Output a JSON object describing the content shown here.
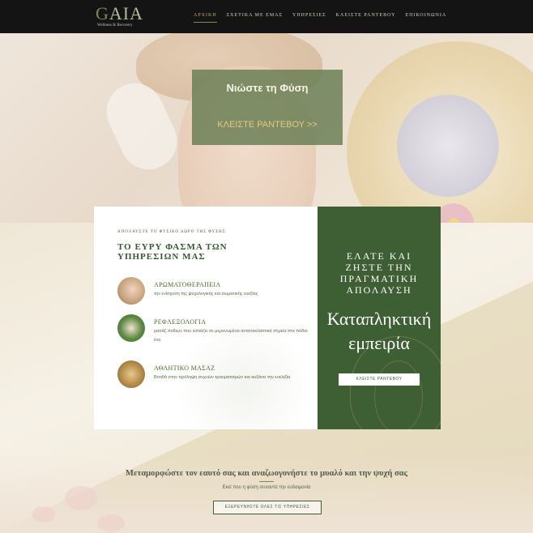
{
  "brand": {
    "logo_text": "AIA",
    "logo_initial": "G",
    "tagline": "Wellness & Recovery"
  },
  "nav": {
    "items": [
      "ΑΡΧΙΚΗ",
      "ΣΧΕΤΙΚΑ ΜΕ ΕΜΑΣ",
      "ΥΠΗΡΕΣΙΕΣ",
      "ΚΛΕΙΣΤΕ ΡΑΝΤΕΒΟΥ",
      "ΕΠΙΚΟΙΝΩΝΙΑ"
    ],
    "active": "ΑΡΧΙΚΗ"
  },
  "hero": {
    "title": "Νιώστε τη Φύση",
    "cta": "ΚΛΕΙΣΤΕ ΡΑΝΤΕΒΟΥ >>"
  },
  "services": {
    "eyebrow": "ΑΠΟΛΑΥΣΤΕ ΤΟ ΦΥΣΙΚΟ ΔΩΡΟ ΤΗΣ ΦΥΣΗΣ",
    "title": "ΤΟ ΕΥΡΥ ΦΑΣΜΑ ΤΩΝ ΥΠΗΡΕΣΙΩΝ ΜΑΣ",
    "items": [
      {
        "name": "ΑΡΩΜΑΤΟΘΕΡΑΠΕΙΑ",
        "desc": "την ενίσχυση της ψυχολογικής και σωματικής ευεξίας"
      },
      {
        "name": "ΡΕΦΛΕΞΟΛΟΓΙΑ",
        "desc": "μασάζ ποδιών που εστιάζει σε μεμονωμένα αντανακλαστικά σημεία στα πόδια ένα"
      },
      {
        "name": "ΑΘΛΗΤΙΚΟ ΜΑΣΑΖ",
        "desc": "Βοηθά στην πρόληψη συχνών τραυματισμών και αυξάνει την ευελιξία"
      }
    ]
  },
  "promo": {
    "heading": "ΕΛΑΤΕ ΚΑΙ ΖΗΣΤΕ ΤΗΝ ΠΡΑΓΜΑΤΙΚΗ ΑΠΟΛΑΥΣΗ",
    "big": "Καταπληκτική εμπειρία",
    "button": "ΚΛΕΙΣΤΕ ΡΑΝΤΕΒΟΥ"
  },
  "bottom": {
    "title": "Μεταμορφώστε τον εαυτό σας και αναζωογονήστε το μυαλό και την ψυχή σας",
    "subtitle": "Εκεί που η φύση συναντά την ευδαιμονία",
    "button": "ΕΞΕΡΕΥΝΗΣΤΕ ΟΛΕΣ ΤΙΣ ΥΠΗΡΕΣΙΕΣ"
  },
  "colors": {
    "nav_bg": "#141414",
    "green": "#3e5e34",
    "hero_box": "#677d52",
    "gold": "#e6c97a"
  }
}
